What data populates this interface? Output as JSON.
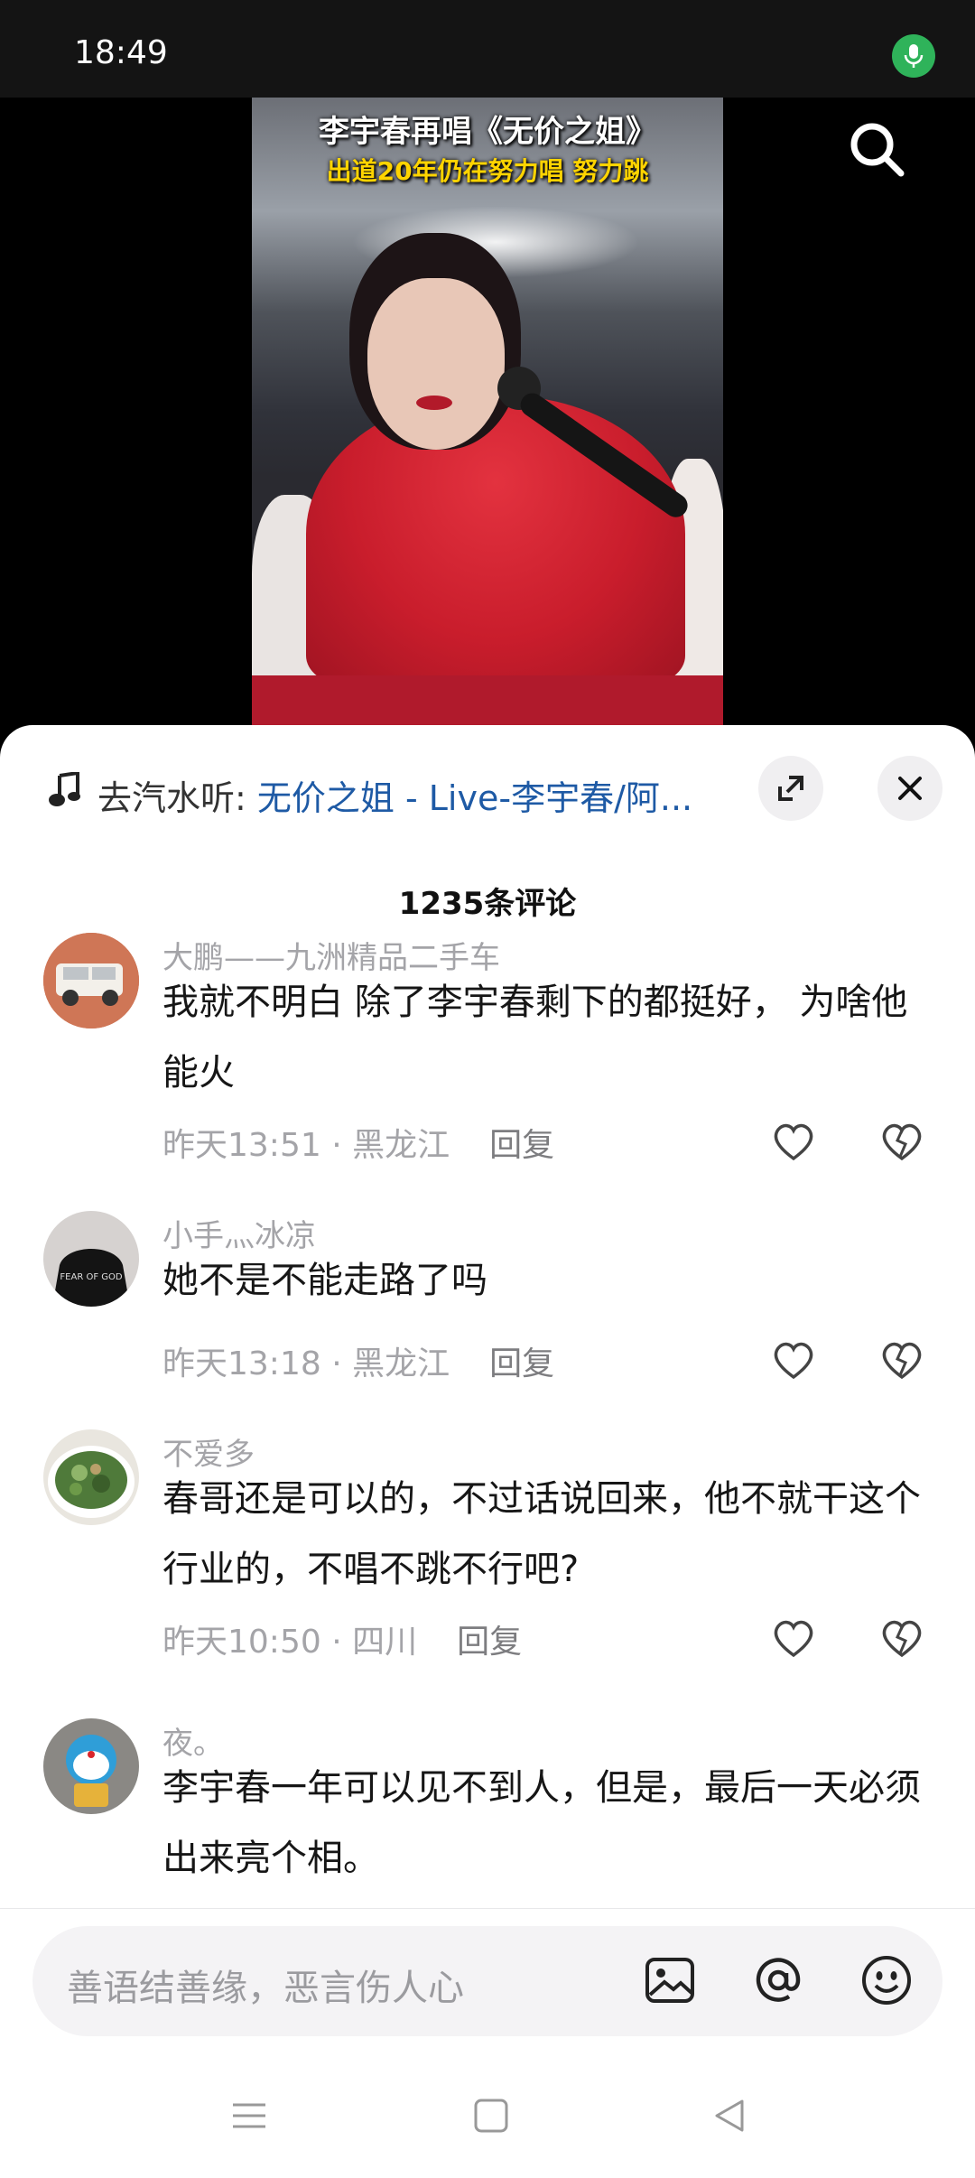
{
  "status_bar": {
    "time": "18:49",
    "mic_indicator": "microphone-icon"
  },
  "video": {
    "title": "李宇春再唱《无价之姐》",
    "subtitle": "出道20年仍在努力唱 努力跳",
    "search_icon": "search-icon"
  },
  "music": {
    "prefix": "去汽水听: ",
    "song": "无价之姐 - Live-李宇春/阿...",
    "icon": "music-note-icon"
  },
  "comments_header": "1235条评论",
  "comments": [
    {
      "user": "大鹏——九洲精品二手车",
      "text": "我就不明白 除了李宇春剩下的都挺好， 为啥他能火",
      "time": "昨天13:51",
      "location": "黑龙江",
      "reply": "回复"
    },
    {
      "user": "小手灬冰凉",
      "text": "她不是不能走路了吗",
      "time": "昨天13:18",
      "location": "黑龙江",
      "reply": "回复"
    },
    {
      "user": "不爱多",
      "text": "春哥还是可以的，不过话说回来，他不就干这个行业的，不唱不跳不行吧?",
      "time": "昨天10:50",
      "location": "四川",
      "reply": "回复"
    },
    {
      "user": "夜。",
      "text": "李宇春一年可以见不到人，但是，最后一天必须出来亮个相。",
      "time": "",
      "location": "",
      "reply": ""
    }
  ],
  "input": {
    "placeholder": "善语结善缘，恶言伤人心",
    "icons": [
      "image-icon",
      "at-icon",
      "emoji-icon"
    ]
  },
  "colors": {
    "accent_link": "#1e5aa5",
    "mic_green": "#2fb35a",
    "muted_text": "#a4a4a8"
  }
}
